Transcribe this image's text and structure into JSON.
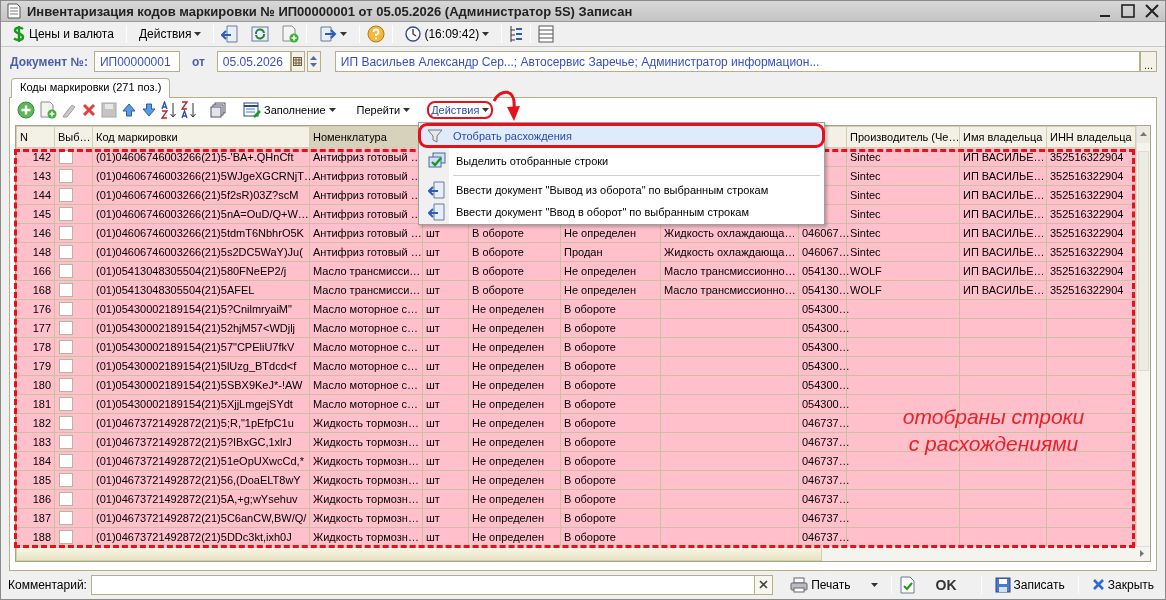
{
  "window": {
    "title": "Инвентаризация кодов маркировки № ИП00000001 от 05.05.2026 (Администратор 5S) Записан"
  },
  "toolbar": {
    "prices": "Цены и валюта",
    "actions": "Действия",
    "time": "(16:09:42)"
  },
  "document": {
    "number_label": "Документ №:",
    "number": "ИП00000001",
    "date_label": "от",
    "date": "05.05.2026",
    "parties": "ИП Васильев Александр Сер...; Автосервис Заречье; Администратор информацион...",
    "parties_button": "..."
  },
  "tabs": [
    {
      "label": "Коды маркировки (271 поз.)",
      "selected": true
    }
  ],
  "table_toolbar": {
    "fill": "Заполнение",
    "goto": "Перейти",
    "actions": {
      "label": "Действия",
      "callout": true
    }
  },
  "actions_menu": {
    "items": [
      {
        "label": "Отобрать расхождения",
        "selected": true,
        "callout": true,
        "kind": "filter"
      },
      {
        "label": "Выделить отобранные строки",
        "selected": false,
        "callout": false,
        "kind": "select"
      },
      {
        "label": "Ввести документ \"Вывод из оборота\" по выбранным строкам",
        "selected": false,
        "callout": false,
        "kind": "document"
      },
      {
        "label": "Ввести документ \"Ввод в оборот\" по выбранным строкам",
        "selected": false,
        "callout": false,
        "kind": "document"
      }
    ]
  },
  "table": {
    "columns": [
      {
        "label": "N",
        "current": false
      },
      {
        "label": "Выб…",
        "current": false
      },
      {
        "label": "Код маркировки",
        "current": false
      },
      {
        "label": "Номенклатура",
        "current": true
      },
      {},
      {},
      {},
      {},
      {},
      {
        "label": "Производитель (Че…",
        "current": false
      },
      {
        "label": "Имя владельца",
        "current": false
      },
      {
        "label": "ИНН владельца",
        "current": false
      }
    ],
    "rows": [
      {
        "checked": false,
        "highlighted": true,
        "cells": [
          "142",
          "",
          "(01)04606746003266(21)5-'BA+.QHnCft",
          "Антифриз готовый …",
          "",
          "",
          "",
          "",
          "",
          "Sintec",
          "ИП ВАСИЛЬЕ…",
          "352516322904"
        ]
      },
      {
        "checked": false,
        "highlighted": true,
        "cells": [
          "143",
          "",
          "(01)04606746003266(21)5WJgeXGCRNjT…",
          "Антифриз готовый …",
          "",
          "",
          "",
          "",
          "",
          "Sintec",
          "ИП ВАСИЛЬЕ…",
          "352516322904"
        ]
      },
      {
        "checked": false,
        "highlighted": true,
        "cells": [
          "144",
          "",
          "(01)04606746003266(21)5f2sR)03Z?scM",
          "Антифриз готовый …",
          "",
          "",
          "",
          "",
          "",
          "Sintec",
          "ИП ВАСИЛЬЕ…",
          "352516322904"
        ]
      },
      {
        "checked": false,
        "highlighted": true,
        "cells": [
          "145",
          "",
          "(01)04606746003266(21)5nA=OuD/Q+W…",
          "Антифриз готовый …",
          "",
          "",
          "",
          "",
          "",
          "Sintec",
          "ИП ВАСИЛЬЕ…",
          "352516322904"
        ]
      },
      {
        "checked": false,
        "highlighted": true,
        "cells": [
          "146",
          "",
          "(01)04606746003266(21)5tdmT6NbhrO5K",
          "Антифриз готовый …",
          "шт",
          "В обороте",
          "Не определен",
          "Жидкость охлаждающа…",
          "046067…",
          "Sintec",
          "ИП ВАСИЛЬЕ…",
          "352516322904"
        ]
      },
      {
        "checked": false,
        "highlighted": true,
        "cells": [
          "148",
          "",
          "(01)04606746003266(21)5s2DC5WaY)Ju(",
          "Антифриз готовый …",
          "шт",
          "В обороте",
          "Продан",
          "Жидкость охлаждающа…",
          "046067…",
          "Sintec",
          "ИП ВАСИЛЬЕ…",
          "352516322904"
        ]
      },
      {
        "checked": false,
        "highlighted": true,
        "cells": [
          "166",
          "",
          "(01)05413048305504(21)580FNeEP2/j",
          "Масло трансмисси…",
          "шт",
          "В обороте",
          "Не определен",
          "Масло трансмиссионно…",
          "054130…",
          "WOLF",
          "ИП ВАСИЛЬЕ…",
          "352516322904"
        ]
      },
      {
        "checked": false,
        "highlighted": true,
        "cells": [
          "168",
          "",
          "(01)05413048305504(21)5AFEL",
          "Масло трансмисси…",
          "шт",
          "В обороте",
          "Не определен",
          "Масло трансмиссионно…",
          "054130…",
          "WOLF",
          "ИП ВАСИЛЬЕ…",
          "352516322904"
        ]
      },
      {
        "checked": false,
        "highlighted": true,
        "cells": [
          "176",
          "",
          "(01)05430002189154(21)5?CnilmryaiM\"",
          "Масло моторное с…",
          "шт",
          "Не определен",
          "В обороте",
          "",
          "054300…",
          "",
          "",
          ""
        ]
      },
      {
        "checked": false,
        "highlighted": true,
        "cells": [
          "177",
          "",
          "(01)05430002189154(21)52hjM57<WDjlj",
          "Масло моторное с…",
          "шт",
          "Не определен",
          "В обороте",
          "",
          "054300…",
          "",
          "",
          ""
        ]
      },
      {
        "checked": false,
        "highlighted": true,
        "cells": [
          "178",
          "",
          "(01)05430002189154(21)57\"CPEliU7fkV",
          "Масло моторное с…",
          "шт",
          "Не определен",
          "В обороте",
          "",
          "054300…",
          "",
          "",
          ""
        ]
      },
      {
        "checked": false,
        "highlighted": true,
        "cells": [
          "179",
          "",
          "(01)05430002189154(21)5lUzg_BTdcd<f",
          "Масло моторное с…",
          "шт",
          "Не определен",
          "В обороте",
          "",
          "054300…",
          "",
          "",
          ""
        ]
      },
      {
        "checked": false,
        "highlighted": true,
        "cells": [
          "180",
          "",
          "(01)05430002189154(21)5SBX9KeJ*-!AW",
          "Масло моторное с…",
          "шт",
          "Не определен",
          "В обороте",
          "",
          "054300…",
          "",
          "",
          ""
        ]
      },
      {
        "checked": false,
        "highlighted": true,
        "cells": [
          "181",
          "",
          "(01)05430002189154(21)5XjjLmgejSYdt",
          "Масло моторное с…",
          "шт",
          "Не определен",
          "В обороте",
          "",
          "054300…",
          "",
          "",
          ""
        ]
      },
      {
        "checked": false,
        "highlighted": true,
        "cells": [
          "182",
          "",
          "(01)04673721492872(21)5;R,\"1pEfpC1u",
          "Жидкость тормозн…",
          "шт",
          "Не определен",
          "В обороте",
          "",
          "046737…",
          "",
          "",
          ""
        ]
      },
      {
        "checked": false,
        "highlighted": true,
        "cells": [
          "183",
          "",
          "(01)04673721492872(21)5?IBxGC,1xlrJ",
          "Жидкость тормозн…",
          "шт",
          "Не определен",
          "В обороте",
          "",
          "046737…",
          "",
          "",
          ""
        ]
      },
      {
        "checked": false,
        "highlighted": true,
        "cells": [
          "184",
          "",
          "(01)04673721492872(21)51eOpUXwcCd,*",
          "Жидкость тормозн…",
          "шт",
          "Не определен",
          "В обороте",
          "",
          "046737…",
          "",
          "",
          ""
        ]
      },
      {
        "checked": false,
        "highlighted": true,
        "cells": [
          "185",
          "",
          "(01)04673721492872(21)56,(DoaELT8wY",
          "Жидкость тормозн…",
          "шт",
          "Не определен",
          "В обороте",
          "",
          "046737…",
          "",
          "",
          ""
        ]
      },
      {
        "checked": false,
        "highlighted": true,
        "cells": [
          "186",
          "",
          "(01)04673721492872(21)5A,+g;wYsehuv",
          "Жидкость тормозн…",
          "шт",
          "Не определен",
          "В обороте",
          "",
          "046737…",
          "",
          "",
          ""
        ]
      },
      {
        "checked": false,
        "highlighted": true,
        "cells": [
          "187",
          "",
          "(01)04673721492872(21)5C6anCW,BW/Q/",
          "Жидкость тормозн…",
          "шт",
          "Не определен",
          "В обороте",
          "",
          "046737…",
          "",
          "",
          ""
        ]
      },
      {
        "checked": false,
        "highlighted": true,
        "cells": [
          "188",
          "",
          "(01)04673721492872(21)5DDc3kt,ixh0J",
          "Жидкость тормозн…",
          "шт",
          "Не определен",
          "В обороте",
          "",
          "046737…",
          "",
          "",
          ""
        ]
      }
    ]
  },
  "annotation": {
    "text": "отобраны строки с расхождениями"
  },
  "comment": {
    "label": "Комментарий:"
  },
  "bottom_buttons": {
    "print": "Печать",
    "ok": "OK",
    "save": "Записать",
    "close": "Закрыть"
  }
}
